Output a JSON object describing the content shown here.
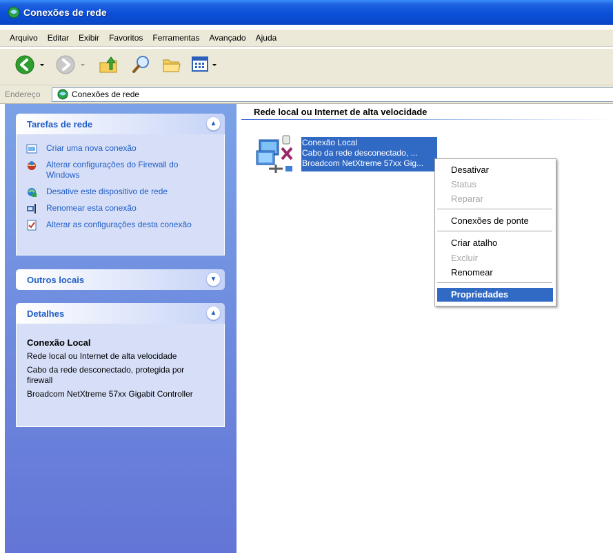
{
  "window": {
    "title": "Conexões de rede"
  },
  "menubar": [
    "Arquivo",
    "Editar",
    "Exibir",
    "Favoritos",
    "Ferramentas",
    "Avançado",
    "Ajuda"
  ],
  "address": {
    "label": "Endereço",
    "value": "Conexões de rede"
  },
  "tasks_box": {
    "title": "Tarefas de rede",
    "items": [
      {
        "label": "Criar uma nova conexão",
        "icon": "new-connection-icon"
      },
      {
        "label": "Alterar configurações do Firewall do Windows",
        "icon": "firewall-icon"
      },
      {
        "label": "Desative este dispositivo de rede",
        "icon": "disable-device-icon"
      },
      {
        "label": "Renomear esta conexão",
        "icon": "rename-icon"
      },
      {
        "label": "Alterar as configurações desta conexão",
        "icon": "properties-icon"
      }
    ]
  },
  "other_places": {
    "title": "Outros locais"
  },
  "details_box": {
    "title": "Detalhes",
    "name": "Conexão Local",
    "type": "Rede local ou Internet de alta velocidade",
    "status": "Cabo da rede desconectado, protegida por firewall",
    "device": "Broadcom NetXtreme 57xx Gigabit Controller"
  },
  "main": {
    "section_title": "Rede local ou Internet de alta velocidade",
    "connection": {
      "name": "Conexão Local",
      "status": "Cabo da rede desconectado, ...",
      "device": "Broadcom NetXtreme 57xx Gig..."
    }
  },
  "context_menu": {
    "items": [
      {
        "label": "Desativar",
        "state": "enabled"
      },
      {
        "label": "Status",
        "state": "disabled"
      },
      {
        "label": "Reparar",
        "state": "disabled"
      },
      {
        "label": "Conexões de ponte",
        "state": "enabled"
      },
      {
        "label": "Criar atalho",
        "state": "enabled"
      },
      {
        "label": "Excluir",
        "state": "disabled"
      },
      {
        "label": "Renomear",
        "state": "enabled"
      },
      {
        "label": "Propriedades",
        "state": "selected"
      }
    ]
  },
  "colors": {
    "title_bar": "#0a46c6",
    "task_link": "#215dc6",
    "selection": "#316ac5",
    "left_pane": "#6375d6"
  }
}
